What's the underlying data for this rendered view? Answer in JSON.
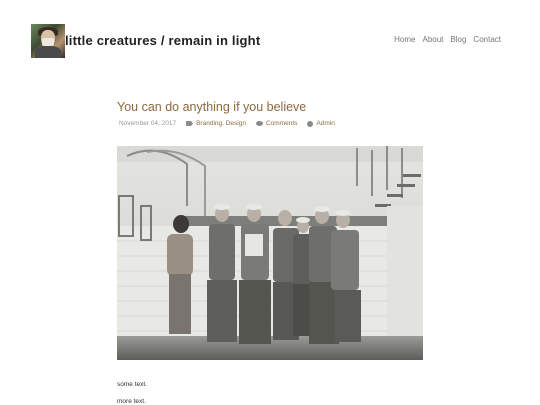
{
  "site": {
    "title": "little creatures / remain in light"
  },
  "nav": {
    "items": [
      "Home",
      "About",
      "Blog",
      "Contact"
    ]
  },
  "post": {
    "title": "You can do anything if you believe",
    "date": "November 04, 2017",
    "categories": "Branding, Design",
    "comments_label": "Comments",
    "author": "Admin",
    "paragraphs": [
      "some text.",
      "more text."
    ]
  },
  "colors": {
    "accent": "#8c6a3f",
    "nav_text": "#777777",
    "meta_text": "#999999"
  },
  "icons": {
    "categories": "tag-icon",
    "comments": "comment-icon",
    "author": "user-icon"
  }
}
